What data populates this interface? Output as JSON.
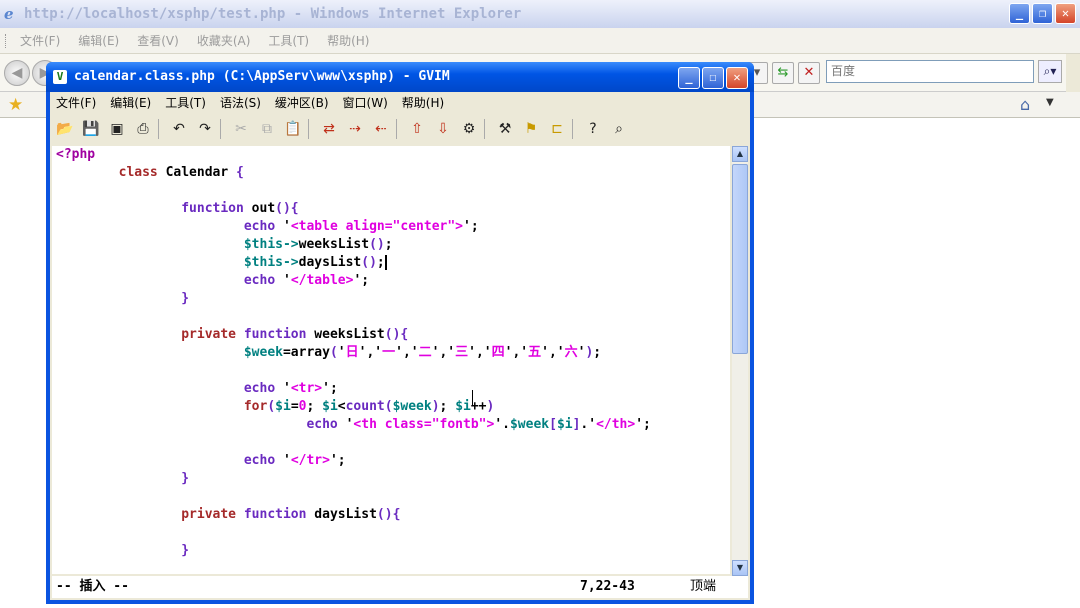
{
  "ie": {
    "title": "http://localhost/xsphp/test.php - Windows Internet Explorer",
    "menu": [
      "文件(F)",
      "编辑(E)",
      "查看(V)",
      "收藏夹(A)",
      "工具(T)",
      "帮助(H)"
    ],
    "search_placeholder": "百度"
  },
  "gvim": {
    "title": "calendar.class.php (C:\\AppServ\\www\\xsphp) - GVIM",
    "menu": [
      "文件(F)",
      "编辑(E)",
      "工具(T)",
      "语法(S)",
      "缓冲区(B)",
      "窗口(W)",
      "帮助(H)"
    ],
    "status": {
      "mode": "-- 插入 --",
      "position": "7,22-43",
      "scroll": "顶端"
    }
  },
  "code": [
    "<?php",
    "        class Calendar {",
    "",
    "                function out(){",
    "                        echo '<table align=\"center\">';",
    "                        $this->weeksList();",
    "                        $this->daysList();",
    "                        echo '</table>';",
    "                }",
    "",
    "                private function weeksList(){",
    "                        $week=array('日','一','二','三','四','五','六');",
    "",
    "                        echo '<tr>';",
    "                        for($i=0; $i<count($week); $i++)",
    "                                echo '<th class=\"fontb\">'.$week[$i].'</th>';",
    "",
    "                        echo '</tr>';",
    "                }",
    "",
    "                private function daysList(){",
    "",
    "                }"
  ]
}
